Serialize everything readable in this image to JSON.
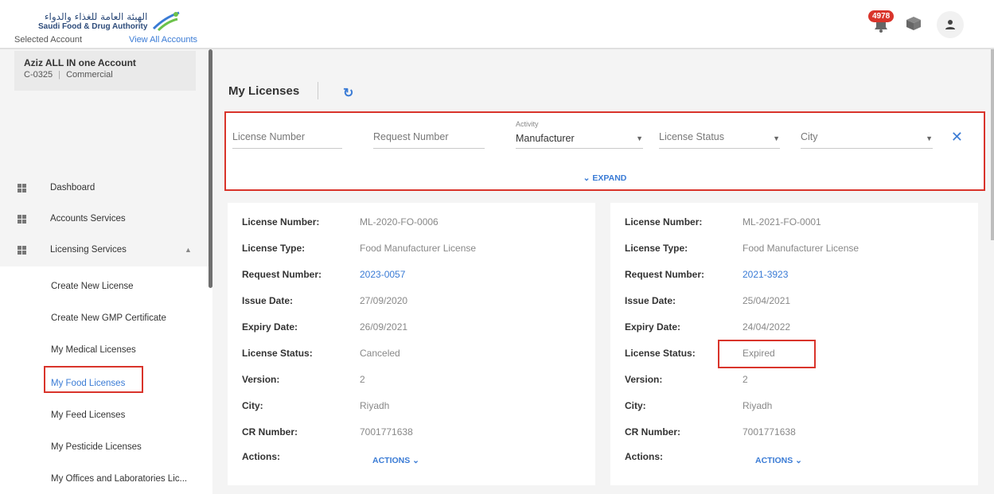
{
  "header": {
    "logo_ar": "الهيئة العامة للغذاء والدواء",
    "logo_en": "Saudi Food & Drug Authority",
    "notification_count": "4978",
    "icons": [
      "bell-icon",
      "box-icon",
      "user-icon"
    ]
  },
  "sidebar": {
    "selected_account_label": "Selected Account",
    "view_all_label": "View All Accounts",
    "account_name": "Aziz ALL IN one Account",
    "account_id": "C-0325",
    "account_type": "Commercial",
    "account_sep": "|",
    "nav": [
      {
        "label": "Dashboard"
      },
      {
        "label": "Accounts Services"
      },
      {
        "label": "Licensing Services"
      }
    ],
    "sub_items": [
      {
        "label": "Create New License"
      },
      {
        "label": "Create New GMP Certificate"
      },
      {
        "label": "My Medical Licenses"
      },
      {
        "label": "My Food Licenses"
      },
      {
        "label": "My Feed Licenses"
      },
      {
        "label": "My Pesticide Licenses"
      },
      {
        "label": "My Offices and Laboratories Lic..."
      }
    ]
  },
  "main": {
    "title": "My Licenses",
    "filters": {
      "license_number_placeholder": "License Number",
      "request_number_placeholder": "Request Number",
      "activity_label": "Activity",
      "activity_value": "Manufacturer",
      "license_status_placeholder": "License Status",
      "city_placeholder": "City",
      "expand_label": "EXPAND"
    },
    "field_labels": {
      "license_number": "License Number:",
      "license_type": "License Type:",
      "request_number": "Request Number:",
      "issue_date": "Issue Date:",
      "expiry_date": "Expiry Date:",
      "license_status": "License Status:",
      "version": "Version:",
      "city": "City:",
      "cr_number": "CR Number:",
      "actions": "Actions:"
    },
    "actions_button": "ACTIONS",
    "cards": [
      {
        "license_number": "ML-2020-FO-0006",
        "license_type": "Food Manufacturer License",
        "request_number": "2023-0057",
        "issue_date": "27/09/2020",
        "expiry_date": "26/09/2021",
        "license_status": "Canceled",
        "version": "2",
        "city": "Riyadh",
        "cr_number": "7001771638"
      },
      {
        "license_number": "ML-2021-FO-0001",
        "license_type": "Food Manufacturer License",
        "request_number": "2021-3923",
        "issue_date": "25/04/2021",
        "expiry_date": "24/04/2022",
        "license_status": "Expired",
        "version": "2",
        "city": "Riyadh",
        "cr_number": "7001771638"
      }
    ]
  },
  "colors": {
    "accent": "#3a7bd5",
    "highlight": "#d9342b",
    "badge": "#d9342b"
  }
}
